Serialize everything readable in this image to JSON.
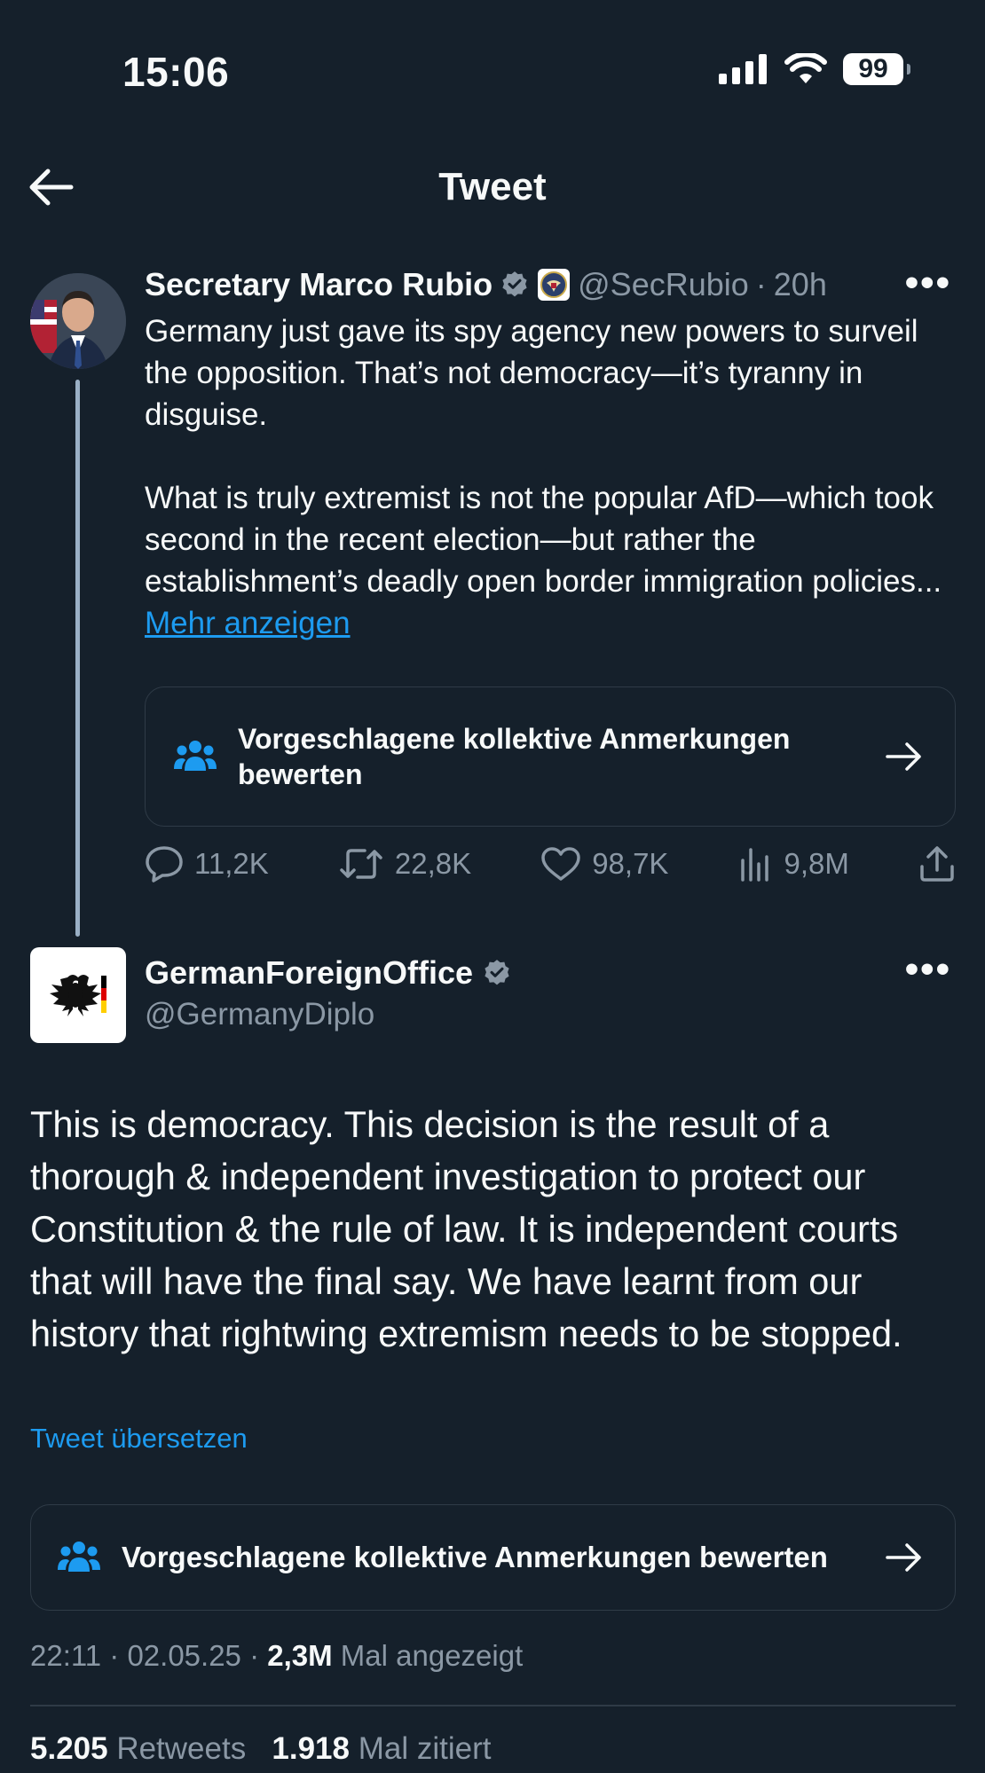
{
  "status_bar": {
    "time": "15:06",
    "battery": "99"
  },
  "header": {
    "title": "Tweet"
  },
  "tweet1": {
    "name": "Secretary Marco Rubio",
    "handle": "@SecRubio",
    "separator": "·",
    "time": "20h",
    "text_p1": "Germany just gave its spy agency new powers to surveil the opposition.  That’s not democracy—it’s tyranny in disguise.",
    "text_p2": "What is truly extremist is not the popular AfD—which took second in the recent election—but rather the establishment’s deadly open border immigration policies... ",
    "more_link": "Mehr anzeigen",
    "note_label": "Vorgeschlagene kollektive Anmerkungen bewerten",
    "replies": "11,2K",
    "retweets": "22,8K",
    "likes": "98,7K",
    "views": "9,8M"
  },
  "tweet2": {
    "name": "GermanForeignOffice",
    "handle": "@GermanyDiplo",
    "text": "This is democracy. This decision is the result of a thorough & independent investigation to protect our Constitution & the rule of law. It is independent courts that will have the final say. We have learnt from our history that rightwing extremism needs to be stopped.",
    "translate_label": "Tweet übersetzen",
    "note_label": "Vorgeschlagene kollektive Anmerkungen bewerten",
    "timestamp": "22:11 · 02.05.25 · ",
    "view_count": "2,3M",
    "view_label": " Mal angezeigt",
    "retweet_count": "5.205",
    "retweet_label": " Retweets",
    "quote_count": "1.918",
    "quote_label": " Mal zitiert"
  },
  "colors": {
    "background": "#15202b",
    "text": "#f7f9f9",
    "muted": "#8b98a5",
    "accent": "#1d9bf0",
    "verified": "#8b98a5",
    "border": "#2f3b47"
  },
  "icons": [
    "back-arrow-icon",
    "verified-badge-icon",
    "state-department-seal-icon",
    "more-icon",
    "community-notes-icon",
    "arrow-right-icon",
    "reply-icon",
    "retweet-icon",
    "like-icon",
    "views-icon",
    "share-icon",
    "cellular-signal-icon",
    "wifi-icon",
    "battery-icon"
  ]
}
